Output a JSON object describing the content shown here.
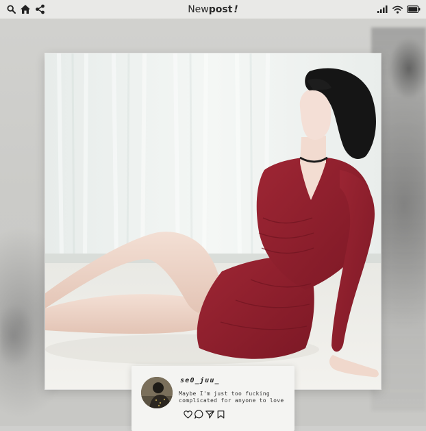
{
  "status_bar": {
    "title_light": "New",
    "title_bold": "post",
    "title_mark": "!",
    "left_icons": [
      "search-icon",
      "home-icon",
      "share-icon"
    ],
    "right_icons": [
      "signal-icon",
      "wifi-icon",
      "battery-icon"
    ]
  },
  "post": {
    "image_subject": "photo",
    "username": "se0_juu_",
    "caption_line1": "Maybe I'm just too fucking",
    "caption_line2": "complicated for anyone to love",
    "actions": [
      "heart-icon",
      "comment-icon",
      "send-icon",
      "bookmark-icon"
    ]
  },
  "colors": {
    "status_bar_bg": "#e9e9e7",
    "dress": "#8f1f2e",
    "card_bg": "#f4f4f2"
  }
}
